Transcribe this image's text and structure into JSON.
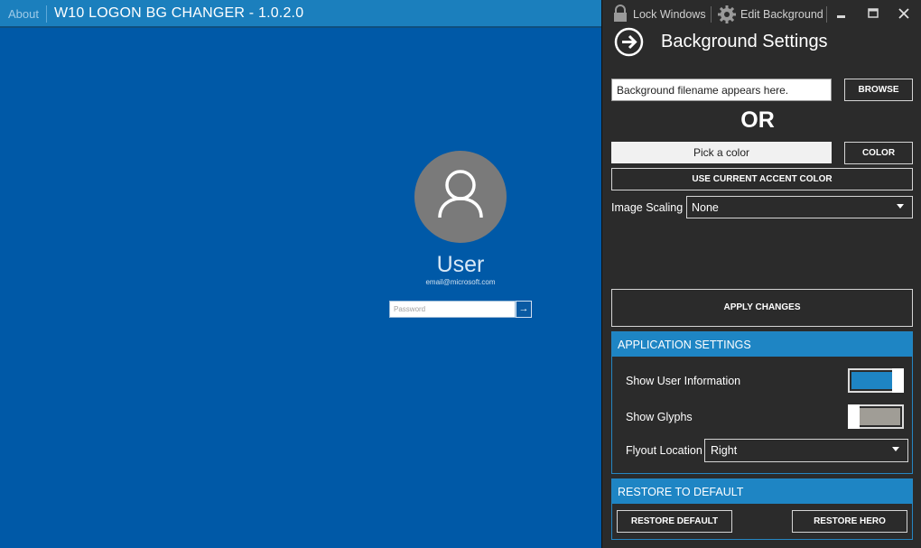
{
  "titlebar": {
    "about_label": "About",
    "app_title": "W10 LOGON BG CHANGER - 1.0.2.0"
  },
  "preview": {
    "user_name": "User",
    "email": "email@microsoft.com",
    "password_placeholder": "Password",
    "background_color": "#0059a7"
  },
  "toolbar": {
    "lock_label": "Lock Windows",
    "edit_label": "Edit Background"
  },
  "panel": {
    "title": "Background Settings",
    "filename_placeholder": "Background filename appears here.",
    "browse_label": "BROWSE",
    "or_label": "OR",
    "pick_color_label": "Pick a color",
    "color_label": "COLOR",
    "accent_label": "USE CURRENT ACCENT COLOR",
    "scaling_label": "Image Scaling",
    "scaling_value": "None",
    "apply_label": "APPLY CHANGES"
  },
  "app_settings": {
    "header": "APPLICATION SETTINGS",
    "show_user_info_label": "Show User Information",
    "show_user_info_on": true,
    "show_glyphs_label": "Show Glyphs",
    "show_glyphs_on": false,
    "flyout_label": "Flyout Location",
    "flyout_value": "Right"
  },
  "restore": {
    "header": "RESTORE TO DEFAULT",
    "restore_default_label": "RESTORE DEFAULT",
    "restore_hero_label": "RESTORE HERO"
  },
  "colors": {
    "accent": "#1e85c4",
    "panel_bg": "#2b2b2b",
    "toggle_on": "#1e85c4",
    "toggle_off": "#a09d96"
  }
}
